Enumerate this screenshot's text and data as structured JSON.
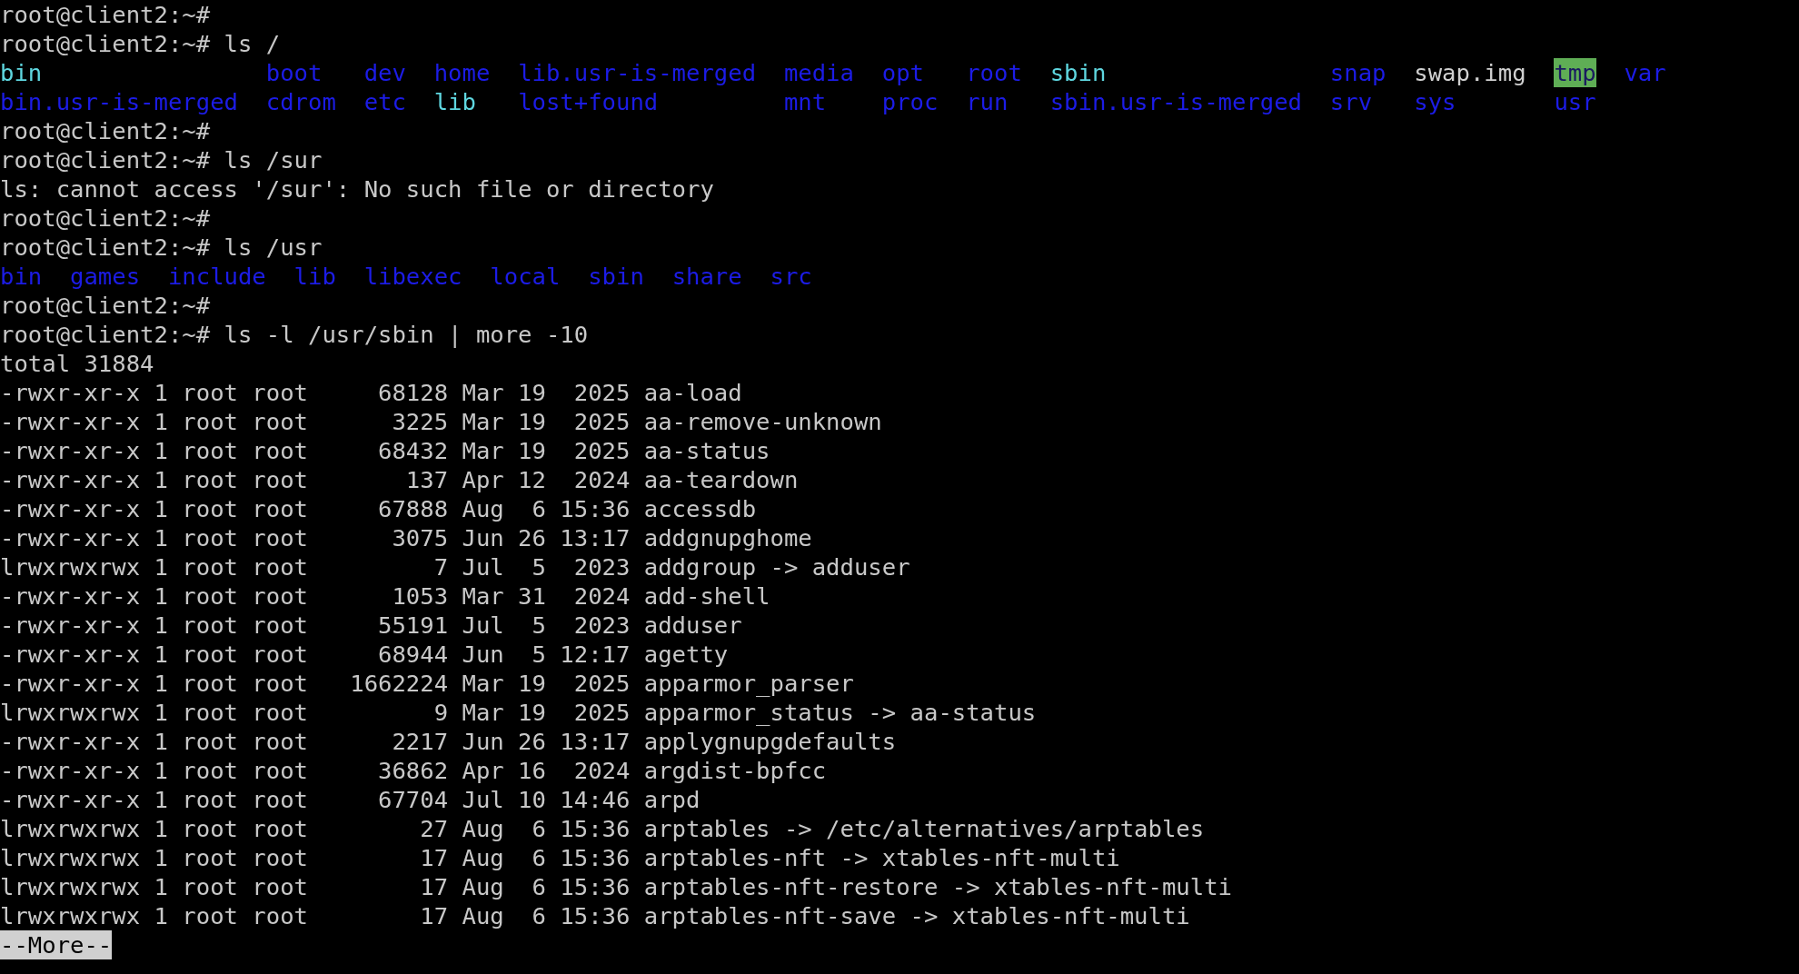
{
  "lines": [
    {
      "kind": "text",
      "text": "root@client2:~#"
    },
    {
      "kind": "text",
      "text": "root@client2:~# ls /"
    },
    {
      "kind": "grid",
      "columns": [
        [
          {
            "name": "bin",
            "kind": "link"
          },
          {
            "name": "bin.usr-is-merged",
            "kind": "dir"
          }
        ],
        [
          {
            "name": "boot",
            "kind": "dir"
          },
          {
            "name": "cdrom",
            "kind": "dir"
          }
        ],
        [
          {
            "name": "dev",
            "kind": "dir"
          },
          {
            "name": "etc",
            "kind": "dir"
          }
        ],
        [
          {
            "name": "home",
            "kind": "dir"
          },
          {
            "name": "lib",
            "kind": "link"
          }
        ],
        [
          {
            "name": "lib.usr-is-merged",
            "kind": "dir"
          },
          {
            "name": "lost+found",
            "kind": "dir"
          }
        ],
        [
          {
            "name": "media",
            "kind": "dir"
          },
          {
            "name": "mnt",
            "kind": "dir"
          }
        ],
        [
          {
            "name": "opt",
            "kind": "dir"
          },
          {
            "name": "proc",
            "kind": "dir"
          }
        ],
        [
          {
            "name": "root",
            "kind": "dir"
          },
          {
            "name": "run",
            "kind": "dir"
          }
        ],
        [
          {
            "name": "sbin",
            "kind": "link"
          },
          {
            "name": "sbin.usr-is-merged",
            "kind": "dir"
          }
        ],
        [
          {
            "name": "snap",
            "kind": "dir"
          },
          {
            "name": "srv",
            "kind": "dir"
          }
        ],
        [
          {
            "name": "swap.img",
            "kind": "file"
          },
          {
            "name": "sys",
            "kind": "dir"
          }
        ],
        [
          {
            "name": "tmp",
            "kind": "sticky"
          },
          {
            "name": "usr",
            "kind": "dir"
          }
        ],
        [
          {
            "name": "var",
            "kind": "dir"
          }
        ]
      ]
    },
    {
      "kind": "text",
      "text": "root@client2:~#"
    },
    {
      "kind": "text",
      "text": "root@client2:~# ls /sur"
    },
    {
      "kind": "text",
      "text": "ls: cannot access '/sur': No such file or directory"
    },
    {
      "kind": "text",
      "text": "root@client2:~#"
    },
    {
      "kind": "text",
      "text": "root@client2:~# ls /usr"
    },
    {
      "kind": "grid",
      "columns": [
        [
          {
            "name": "bin",
            "kind": "dir"
          }
        ],
        [
          {
            "name": "games",
            "kind": "dir"
          }
        ],
        [
          {
            "name": "include",
            "kind": "dir"
          }
        ],
        [
          {
            "name": "lib",
            "kind": "dir"
          }
        ],
        [
          {
            "name": "libexec",
            "kind": "dir"
          }
        ],
        [
          {
            "name": "local",
            "kind": "dir"
          }
        ],
        [
          {
            "name": "sbin",
            "kind": "dir"
          }
        ],
        [
          {
            "name": "share",
            "kind": "dir"
          }
        ],
        [
          {
            "name": "src",
            "kind": "dir"
          }
        ]
      ]
    },
    {
      "kind": "text",
      "text": "root@client2:~#"
    },
    {
      "kind": "text",
      "text": "root@client2:~# ls -l /usr/sbin | more -10"
    },
    {
      "kind": "text",
      "text": "total 31884"
    },
    {
      "kind": "text",
      "text": "-rwxr-xr-x 1 root root     68128 Mar 19  2025 aa-load"
    },
    {
      "kind": "text",
      "text": "-rwxr-xr-x 1 root root      3225 Mar 19  2025 aa-remove-unknown"
    },
    {
      "kind": "text",
      "text": "-rwxr-xr-x 1 root root     68432 Mar 19  2025 aa-status"
    },
    {
      "kind": "text",
      "text": "-rwxr-xr-x 1 root root       137 Apr 12  2024 aa-teardown"
    },
    {
      "kind": "text",
      "text": "-rwxr-xr-x 1 root root     67888 Aug  6 15:36 accessdb"
    },
    {
      "kind": "text",
      "text": "-rwxr-xr-x 1 root root      3075 Jun 26 13:17 addgnupghome"
    },
    {
      "kind": "text",
      "text": "lrwxrwxrwx 1 root root         7 Jul  5  2023 addgroup -> adduser"
    },
    {
      "kind": "text",
      "text": "-rwxr-xr-x 1 root root      1053 Mar 31  2024 add-shell"
    },
    {
      "kind": "text",
      "text": "-rwxr-xr-x 1 root root     55191 Jul  5  2023 adduser"
    },
    {
      "kind": "text",
      "text": "-rwxr-xr-x 1 root root     68944 Jun  5 12:17 agetty"
    },
    {
      "kind": "text",
      "text": "-rwxr-xr-x 1 root root   1662224 Mar 19  2025 apparmor_parser"
    },
    {
      "kind": "text",
      "text": "lrwxrwxrwx 1 root root         9 Mar 19  2025 apparmor_status -> aa-status"
    },
    {
      "kind": "text",
      "text": "-rwxr-xr-x 1 root root      2217 Jun 26 13:17 applygnupgdefaults"
    },
    {
      "kind": "text",
      "text": "-rwxr-xr-x 1 root root     36862 Apr 16  2024 argdist-bpfcc"
    },
    {
      "kind": "text",
      "text": "-rwxr-xr-x 1 root root     67704 Jul 10 14:46 arpd"
    },
    {
      "kind": "text",
      "text": "lrwxrwxrwx 1 root root        27 Aug  6 15:36 arptables -> /etc/alternatives/arptables"
    },
    {
      "kind": "text",
      "text": "lrwxrwxrwx 1 root root        17 Aug  6 15:36 arptables-nft -> xtables-nft-multi"
    },
    {
      "kind": "text",
      "text": "lrwxrwxrwx 1 root root        17 Aug  6 15:36 arptables-nft-restore -> xtables-nft-multi"
    },
    {
      "kind": "text",
      "text": "lrwxrwxrwx 1 root root        17 Aug  6 15:36 arptables-nft-save -> xtables-nft-multi"
    }
  ],
  "pager": {
    "text": "--More--"
  }
}
